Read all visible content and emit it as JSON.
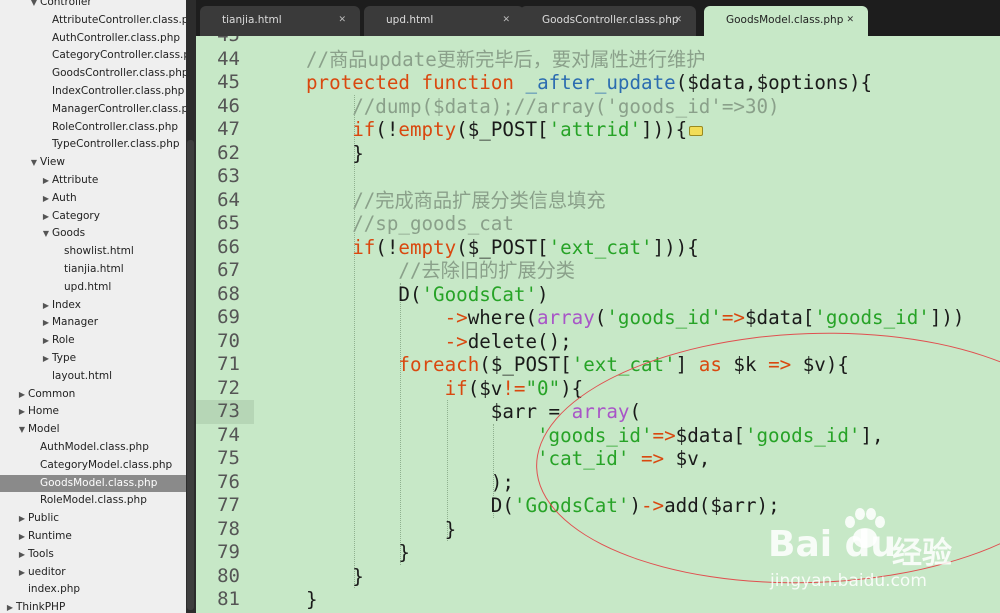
{
  "sidebar": {
    "items": [
      {
        "label": "Controller",
        "indent": 2,
        "arrow": "open"
      },
      {
        "label": "AttributeController.class.p",
        "indent": 3,
        "arrow": ""
      },
      {
        "label": "AuthController.class.php",
        "indent": 3,
        "arrow": ""
      },
      {
        "label": "CategoryController.class.p",
        "indent": 3,
        "arrow": ""
      },
      {
        "label": "GoodsController.class.php",
        "indent": 3,
        "arrow": ""
      },
      {
        "label": "IndexController.class.php",
        "indent": 3,
        "arrow": ""
      },
      {
        "label": "ManagerController.class.p",
        "indent": 3,
        "arrow": ""
      },
      {
        "label": "RoleController.class.php",
        "indent": 3,
        "arrow": ""
      },
      {
        "label": "TypeController.class.php",
        "indent": 3,
        "arrow": ""
      },
      {
        "label": "View",
        "indent": 2,
        "arrow": "open"
      },
      {
        "label": "Attribute",
        "indent": 3,
        "arrow": "closed"
      },
      {
        "label": "Auth",
        "indent": 3,
        "arrow": "closed"
      },
      {
        "label": "Category",
        "indent": 3,
        "arrow": "closed"
      },
      {
        "label": "Goods",
        "indent": 3,
        "arrow": "open"
      },
      {
        "label": "showlist.html",
        "indent": 4,
        "arrow": ""
      },
      {
        "label": "tianjia.html",
        "indent": 4,
        "arrow": ""
      },
      {
        "label": "upd.html",
        "indent": 4,
        "arrow": ""
      },
      {
        "label": "Index",
        "indent": 3,
        "arrow": "closed"
      },
      {
        "label": "Manager",
        "indent": 3,
        "arrow": "closed"
      },
      {
        "label": "Role",
        "indent": 3,
        "arrow": "closed"
      },
      {
        "label": "Type",
        "indent": 3,
        "arrow": "closed"
      },
      {
        "label": "layout.html",
        "indent": 3,
        "arrow": ""
      },
      {
        "label": "Common",
        "indent": 1,
        "arrow": "closed"
      },
      {
        "label": "Home",
        "indent": 1,
        "arrow": "closed"
      },
      {
        "label": "Model",
        "indent": 1,
        "arrow": "open"
      },
      {
        "label": "AuthModel.class.php",
        "indent": 2,
        "arrow": ""
      },
      {
        "label": "CategoryModel.class.php",
        "indent": 2,
        "arrow": ""
      },
      {
        "label": "GoodsModel.class.php",
        "indent": 2,
        "arrow": "",
        "selected": true
      },
      {
        "label": "RoleModel.class.php",
        "indent": 2,
        "arrow": ""
      },
      {
        "label": "Public",
        "indent": 1,
        "arrow": "closed"
      },
      {
        "label": "Runtime",
        "indent": 1,
        "arrow": "closed"
      },
      {
        "label": "Tools",
        "indent": 1,
        "arrow": "closed"
      },
      {
        "label": "ueditor",
        "indent": 1,
        "arrow": "closed"
      },
      {
        "label": "index.php",
        "indent": 1,
        "arrow": ""
      },
      {
        "label": "ThinkPHP",
        "indent": 0,
        "arrow": "closed"
      }
    ]
  },
  "tabs": [
    {
      "label": "tianjia.html",
      "close": "✕",
      "active": false
    },
    {
      "label": "upd.html",
      "close": "✕",
      "active": false
    },
    {
      "label": "GoodsController.class.php",
      "close": "✕",
      "active": false
    },
    {
      "label": "GoodsModel.class.php",
      "close": "✕",
      "active": true
    }
  ],
  "editor": {
    "current_line": "73",
    "lines": [
      {
        "num": "45",
        "indent": 0,
        "tokens": []
      },
      {
        "num": "44",
        "indent": 0,
        "tokens": [
          [
            "cm",
            "//商品update更新完毕后，要对属性进行维护"
          ]
        ]
      },
      {
        "num": "45",
        "indent": 0,
        "tokens": [
          [
            "kw",
            "protected"
          ],
          [
            "pl",
            " "
          ],
          [
            "kw",
            "function"
          ],
          [
            "pl",
            " "
          ],
          [
            "fn",
            "_after_update"
          ],
          [
            "pl",
            "($data,$options){"
          ]
        ]
      },
      {
        "num": "46",
        "indent": 1,
        "tokens": [
          [
            "cm",
            "//dump($data);//array('goods_id'=>30)"
          ]
        ]
      },
      {
        "num": "47",
        "indent": 1,
        "tokens": [
          [
            "kw",
            "if"
          ],
          [
            "pl",
            "(!"
          ],
          [
            "kw",
            "empty"
          ],
          [
            "pl",
            "($_POST["
          ],
          [
            "str",
            "'attrid'"
          ],
          [
            "pl",
            "])){"
          ],
          [
            "fold",
            ""
          ]
        ]
      },
      {
        "num": "62",
        "indent": 1,
        "tokens": [
          [
            "pl",
            "}"
          ]
        ]
      },
      {
        "num": "63",
        "indent": 0,
        "tokens": []
      },
      {
        "num": "64",
        "indent": 1,
        "tokens": [
          [
            "cm",
            "//完成商品扩展分类信息填充"
          ]
        ]
      },
      {
        "num": "65",
        "indent": 1,
        "tokens": [
          [
            "cm",
            "//sp_goods_cat"
          ]
        ]
      },
      {
        "num": "66",
        "indent": 1,
        "tokens": [
          [
            "kw",
            "if"
          ],
          [
            "pl",
            "(!"
          ],
          [
            "kw",
            "empty"
          ],
          [
            "pl",
            "($_POST["
          ],
          [
            "str",
            "'ext_cat'"
          ],
          [
            "pl",
            "])){"
          ]
        ]
      },
      {
        "num": "67",
        "indent": 2,
        "tokens": [
          [
            "cm",
            "//去除旧的扩展分类"
          ]
        ]
      },
      {
        "num": "68",
        "indent": 2,
        "tokens": [
          [
            "pl",
            "D("
          ],
          [
            "str",
            "'GoodsCat'"
          ],
          [
            "pl",
            ")"
          ]
        ]
      },
      {
        "num": "69",
        "indent": 3,
        "tokens": [
          [
            "ar",
            "->"
          ],
          [
            "pl",
            "where("
          ],
          [
            "pu",
            "array"
          ],
          [
            "pl",
            "("
          ],
          [
            "str",
            "'goods_id'"
          ],
          [
            "ar",
            "=>"
          ],
          [
            "pl",
            "$data["
          ],
          [
            "str",
            "'goods_id'"
          ],
          [
            "pl",
            "]))"
          ]
        ]
      },
      {
        "num": "70",
        "indent": 3,
        "tokens": [
          [
            "ar",
            "->"
          ],
          [
            "pl",
            "delete();"
          ]
        ]
      },
      {
        "num": "71",
        "indent": 2,
        "tokens": [
          [
            "kw",
            "foreach"
          ],
          [
            "pl",
            "($_POST["
          ],
          [
            "str",
            "'ext_cat'"
          ],
          [
            "pl",
            "] "
          ],
          [
            "kw",
            "as"
          ],
          [
            "pl",
            " $k "
          ],
          [
            "ar",
            "=>"
          ],
          [
            "pl",
            " $v){"
          ]
        ]
      },
      {
        "num": "72",
        "indent": 3,
        "tokens": [
          [
            "kw",
            "if"
          ],
          [
            "pl",
            "($v"
          ],
          [
            "ar",
            "!="
          ],
          [
            "str",
            "\"0\""
          ],
          [
            "pl",
            "){"
          ]
        ]
      },
      {
        "num": "73",
        "indent": 4,
        "tokens": [
          [
            "pl",
            "$arr = "
          ],
          [
            "pu",
            "array"
          ],
          [
            "pl",
            "("
          ]
        ]
      },
      {
        "num": "74",
        "indent": 5,
        "tokens": [
          [
            "str",
            "'goods_id'"
          ],
          [
            "ar",
            "=>"
          ],
          [
            "pl",
            "$data["
          ],
          [
            "str",
            "'goods_id'"
          ],
          [
            "pl",
            "],"
          ]
        ]
      },
      {
        "num": "75",
        "indent": 5,
        "tokens": [
          [
            "str",
            "'cat_id'"
          ],
          [
            "pl",
            " "
          ],
          [
            "ar",
            "=>"
          ],
          [
            "pl",
            " $v,"
          ]
        ]
      },
      {
        "num": "76",
        "indent": 4,
        "tokens": [
          [
            "pl",
            ");"
          ]
        ]
      },
      {
        "num": "77",
        "indent": 4,
        "tokens": [
          [
            "pl",
            "D("
          ],
          [
            "str",
            "'GoodsCat'"
          ],
          [
            "pl",
            ")"
          ],
          [
            "ar",
            "->"
          ],
          [
            "pl",
            "add($arr);"
          ]
        ]
      },
      {
        "num": "78",
        "indent": 3,
        "tokens": [
          [
            "pl",
            "}"
          ]
        ]
      },
      {
        "num": "79",
        "indent": 2,
        "tokens": [
          [
            "pl",
            "}"
          ]
        ]
      },
      {
        "num": "80",
        "indent": 1,
        "tokens": [
          [
            "pl",
            "}"
          ]
        ]
      },
      {
        "num": "81",
        "indent": 0,
        "tokens": [
          [
            "pl",
            "}"
          ]
        ]
      }
    ]
  },
  "watermark": {
    "logo": "Bai du",
    "cn": "经验",
    "url": "jingyan.baidu.com"
  }
}
